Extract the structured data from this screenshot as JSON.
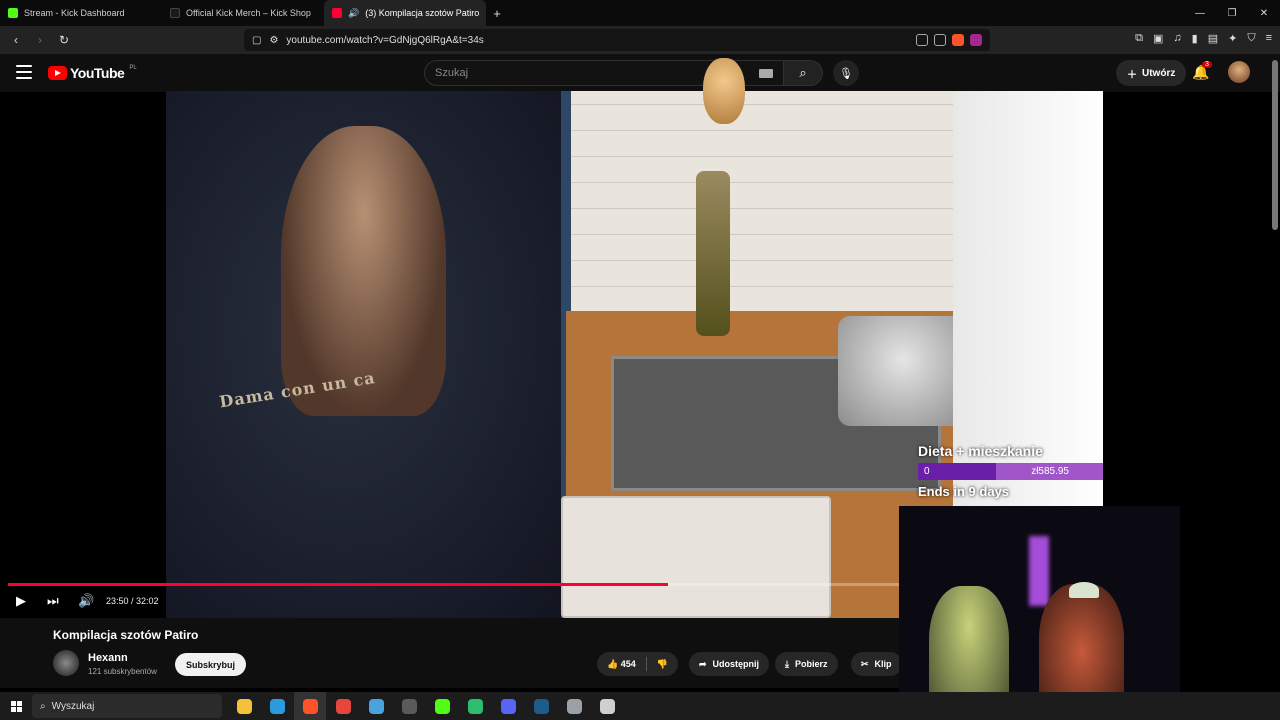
{
  "browser": {
    "tabs": [
      {
        "label": "Stream - Kick Dashboard",
        "color": "#53fc18"
      },
      {
        "label": "Official Kick Merch – Kick Shop",
        "color": "#111111"
      },
      {
        "label": "(3) Kompilacja szotów Patiro",
        "color": "#ff0033",
        "active": true
      }
    ],
    "close_glyph": "×",
    "new_tab_glyph": "+",
    "url": "youtube.com/watch?v=GdNjgQ6lRgA&t=34s",
    "window_controls": [
      "—",
      "❐",
      "✕"
    ]
  },
  "youtube": {
    "logo_text": "YouTube",
    "region": "PL",
    "search_placeholder": "Szukaj",
    "create_label": "Utwórz",
    "notifications_count": "3"
  },
  "video": {
    "shirt_text": "Dama con un ca",
    "progress": 0.7396,
    "time_current": "23:50",
    "time_total": "32:02",
    "time_display": "23:50 / 32:02"
  },
  "overlay": {
    "goal_title": "Dieta + mieszkanie",
    "current": "0",
    "goal_amount": "zł585.95",
    "ends": "Ends in 9 days",
    "fill": 0.42
  },
  "meta": {
    "title": "Kompilacja szotów Patiro",
    "channel_name": "Hexann",
    "subscribers": "121 subskrybentów",
    "subscribe_label": "Subskrybuj",
    "likes": "454",
    "share_label": "Udostępnij",
    "download_label": "Pobierz",
    "clip_label": "Klip"
  },
  "taskbar": {
    "search_label": "Wyszukaj",
    "apps": [
      {
        "name": "file-explorer",
        "color": "#f3c23a"
      },
      {
        "name": "edge",
        "color": "#2b9be0"
      },
      {
        "name": "brave",
        "color": "#fb542b",
        "active": true
      },
      {
        "name": "chrome",
        "color": "#e8453c"
      },
      {
        "name": "ccleaner",
        "color": "#4aa3df"
      },
      {
        "name": "obs",
        "color": "#5a5a5a"
      },
      {
        "name": "kick",
        "color": "#53fc18"
      },
      {
        "name": "app-green",
        "color": "#2dbd6e"
      },
      {
        "name": "discord",
        "color": "#5865f2"
      },
      {
        "name": "steam",
        "color": "#1b5c8a"
      },
      {
        "name": "app-gray",
        "color": "#9aa0a6"
      },
      {
        "name": "app-shield",
        "color": "#cfcfcf"
      }
    ]
  },
  "colors": {
    "accent_red": "#ff0033",
    "goal_purple": "#6a1fa8",
    "goal_bar": "#a055c8"
  }
}
